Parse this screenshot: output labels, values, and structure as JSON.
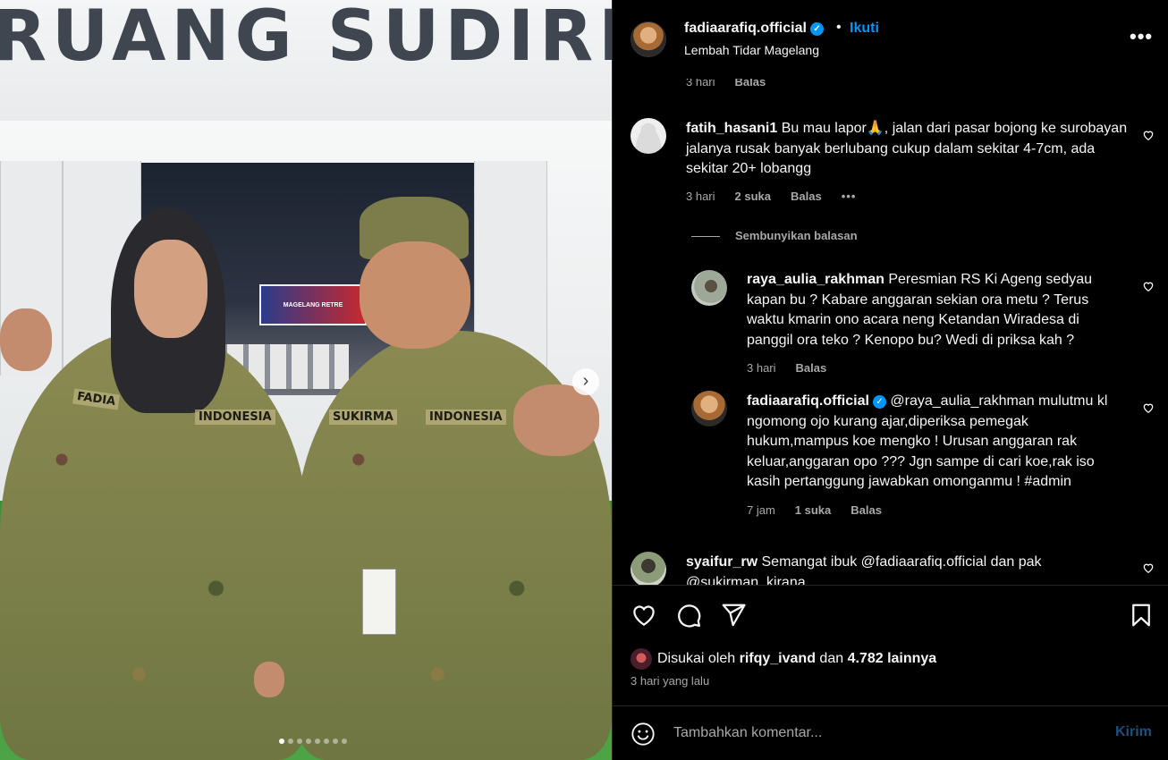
{
  "photo": {
    "sign_text": "RUANG SUDIRMAN",
    "banner_text": "MAGELANG RETRE",
    "name_tags": [
      "FADIA",
      "INDONESIA",
      "SUKIRMA",
      "INDONESIA"
    ],
    "carousel": {
      "count": 8,
      "active_index": 0
    }
  },
  "header": {
    "username": "fadiaarafiq.official",
    "verified": true,
    "separator": "•",
    "follow_label": "Ikuti",
    "location": "Lembah Tidar Magelang",
    "more_label": "•••"
  },
  "comments": {
    "prev_meta": {
      "time": "3 hari",
      "reply": "Balas"
    },
    "items": [
      {
        "username": "fatih_hasani1",
        "text": "Bu mau lapor🙏, jalan dari pasar bojong ke surobayan jalanya rusak banyak berlubang cukup dalam sekitar 4-7cm, ada sekitar 20+ lobangg",
        "time": "3 hari",
        "likes": "2 suka",
        "reply": "Balas",
        "more": "•••",
        "replies_toggle": "Sembunyikan balasan",
        "replies": [
          {
            "username": "raya_aulia_rakhman",
            "text": "Peresmian RS Ki Ageng sedyau kapan bu ? Kabare anggaran sekian ora metu ? Terus waktu kmarin ono acara neng Ketandan Wiradesa di panggil ora teko ? Kenopo bu? Wedi di priksa kah ?",
            "time": "3 hari",
            "reply": "Balas"
          },
          {
            "username": "fadiaarafiq.official",
            "verified": true,
            "text": "@raya_aulia_rakhman mulutmu kl ngomong ojo kurang ajar,diperiksa pemegak hukum,mampus koe mengko ! Urusan anggaran rak keluar,anggaran opo ??? Jgn sampe di cari koe,rak iso kasih pertanggung jawabkan omonganmu ! #admin",
            "time": "7 jam",
            "likes": "1 suka",
            "reply": "Balas"
          }
        ]
      },
      {
        "username": "syaifur_rw",
        "text": "Semangat ibuk @fadiaarafiq.official dan pak @sukirman_kirana"
      }
    ]
  },
  "actions": {
    "likes_prefix": "Disukai oleh",
    "liked_by": "rifqy_ivand",
    "likes_middle": "dan",
    "likes_count": "4.782 lainnya",
    "date": "3 hari yang lalu",
    "comment_placeholder": "Tambahkan komentar...",
    "send_label": "Kirim"
  },
  "colors": {
    "accent": "#0095f6",
    "muted": "#a8a8a8",
    "background": "#000000",
    "text": "#f5f5f5"
  },
  "icons": [
    "heart-icon",
    "comment-icon",
    "share-icon",
    "bookmark-icon",
    "emoji-icon",
    "more-icon",
    "verified-icon",
    "chevron-right-icon"
  ]
}
